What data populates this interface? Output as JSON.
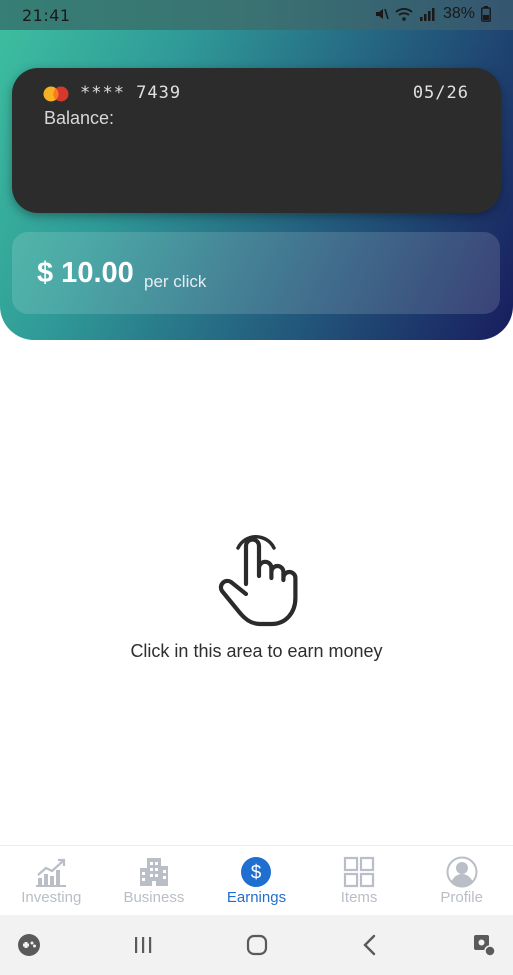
{
  "status_bar": {
    "time": "21:41",
    "battery": "38%",
    "icons": [
      "mute-icon",
      "wifi-icon",
      "signal-icon",
      "battery-icon"
    ]
  },
  "card": {
    "brand": "mastercard-icon",
    "number_masked": "**** 7439",
    "expiry": "05/26",
    "balance_label": "Balance:",
    "balance_value": ""
  },
  "earnings": {
    "amount": "$ 10.00",
    "unit": "per click"
  },
  "click_area": {
    "icon": "tap-hand-icon",
    "hint": "Click in this area to earn money"
  },
  "bottom_nav": {
    "items": [
      {
        "label": "Investing",
        "icon": "chart-growth-icon",
        "active": false
      },
      {
        "label": "Business",
        "icon": "buildings-icon",
        "active": false
      },
      {
        "label": "Earnings",
        "icon": "dollar-circle-icon",
        "active": true
      },
      {
        "label": "Items",
        "icon": "grid-icon",
        "active": false
      },
      {
        "label": "Profile",
        "icon": "user-avatar-icon",
        "active": false
      }
    ]
  },
  "system_nav": {
    "buttons": [
      "game-launcher-icon",
      "recent-apps-icon",
      "home-icon",
      "back-icon",
      "assistant-icon"
    ]
  },
  "colors": {
    "gradient_start": "#3ec0a0",
    "gradient_end": "#181d5e",
    "card_bg": "#2c2c2c",
    "accent": "#1f6fd1",
    "nav_inactive": "#b9bec7"
  }
}
